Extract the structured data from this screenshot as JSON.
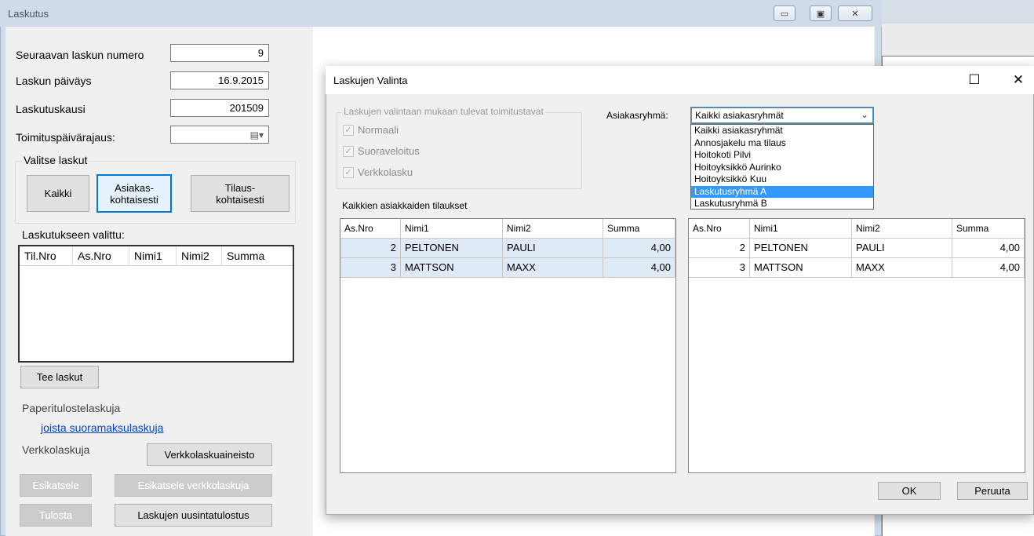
{
  "main_window": {
    "title": "Laskutus",
    "next_invoice_number": {
      "label": "Seuraavan laskun numero",
      "value": "9"
    },
    "invoice_date": {
      "label": "Laskun päiväys",
      "value": "16.9.2015"
    },
    "billing_period": {
      "label": "Laskutuskausi",
      "value": "201509"
    },
    "delivery_date_limit": {
      "label": "Toimituspäivärajaus:",
      "value": ""
    },
    "select_invoices": {
      "title": "Valitse laskut",
      "all": "Kaikki",
      "per_customer_1": "Asiakas-",
      "per_customer_2": "kohtaisesti",
      "per_order_1": "Tilaus-",
      "per_order_2": "kohtaisesti"
    },
    "selected_label": "Laskutukseen valittu:",
    "selected_columns": [
      "Til.Nro",
      "As.Nro",
      "Nimi1",
      "Nimi2",
      "Summa"
    ],
    "make_invoices": "Tee laskut",
    "paper_invoices": "Paperitulostelaskuja",
    "direct_payment_link": "joista suoramaksulaskuja",
    "e_invoices": "Verkkolaskuja",
    "e_invoice_material": "Verkkolaskuaineisto",
    "preview": "Esikatsele",
    "preview_e": "Esikatsele verkkolaskuja",
    "print": "Tulosta",
    "reprint": "Laskujen uusintatulostus"
  },
  "dialog": {
    "title": "Laskujen Valinta",
    "delivery_group_title": "Laskujen valintaan mukaan tulevat toimitustavat",
    "delivery_options": [
      "Normaali",
      "Suoraveloitus",
      "Verkkolasku"
    ],
    "customer_group_label": "Asiakasryhmä:",
    "customer_group_value": "Kaikki asiakasryhmät",
    "customer_group_options": [
      "Kaikki asiakasryhmät",
      "Annosjakelu ma tilaus",
      "Hoitokoti Pilvi",
      "Hoitoyksikkö Aurinko",
      "Hoitoyksikkö Kuu",
      "Laskutusryhmä A",
      "Laskutusryhmä B"
    ],
    "selected_option_index": 5,
    "all_orders_label": "Kaikkien asiakkaiden tilaukset",
    "columns": [
      "As.Nro",
      "Nimi1",
      "Nimi2",
      "Summa"
    ],
    "left_rows": [
      [
        "2",
        "PELTONEN",
        "PAULI",
        "4,00"
      ],
      [
        "3",
        "MATTSON",
        "MAXX",
        "4,00"
      ]
    ],
    "right_rows": [
      [
        "2",
        "PELTONEN",
        "PAULI",
        "4,00"
      ],
      [
        "3",
        "MATTSON",
        "MAXX",
        "4,00"
      ]
    ],
    "ok": "OK",
    "cancel": "Peruuta",
    "minimize_icon": "☐",
    "close_icon": "✕"
  }
}
